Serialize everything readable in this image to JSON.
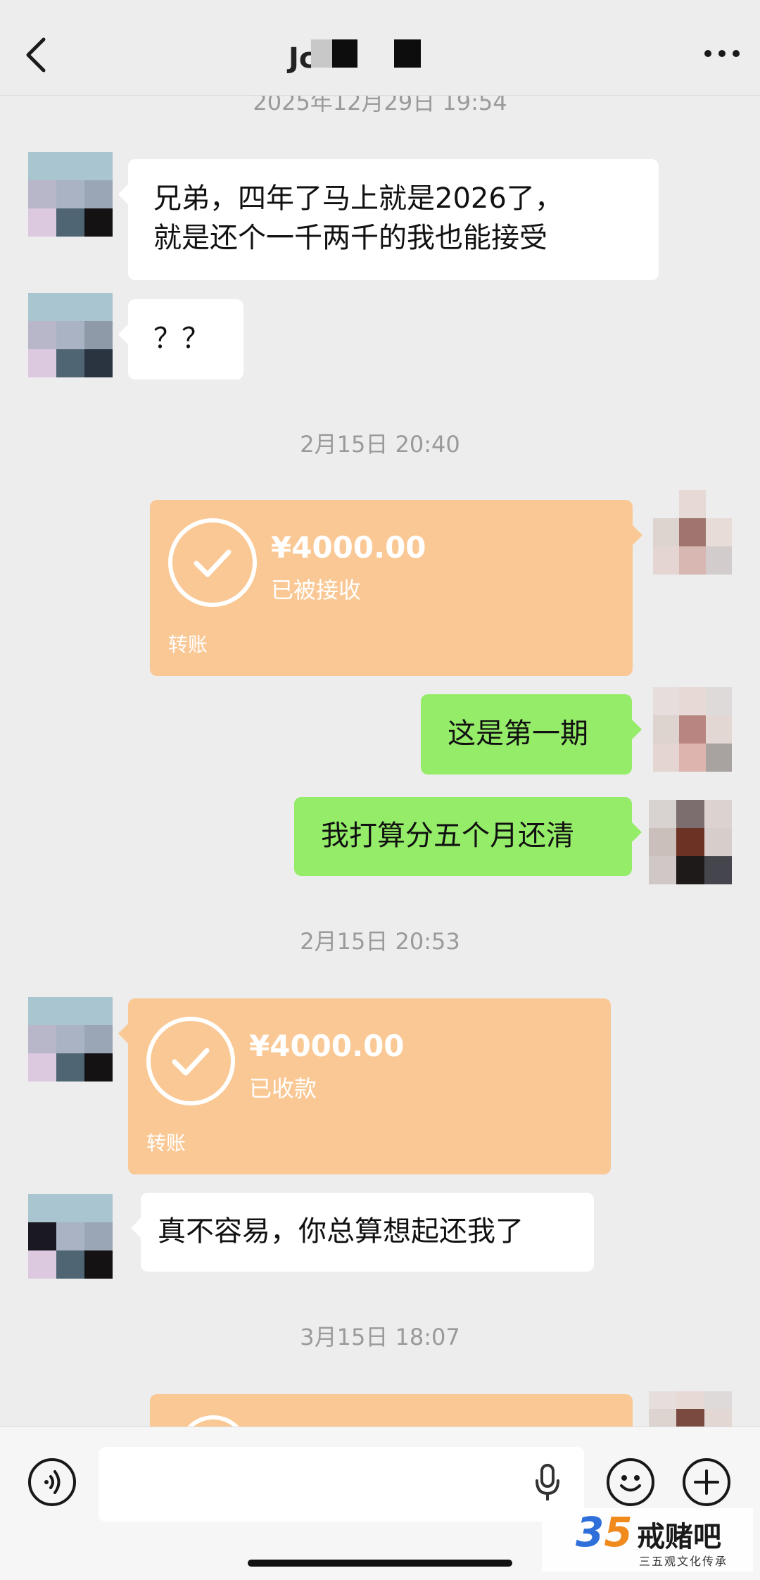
{
  "header": {
    "title": "Jc",
    "back_icon": "chevron-left-icon",
    "more_icon": "more-icon"
  },
  "messages": {
    "ts1": "2025年12月29日 19:54",
    "m1_line1": "兄弟，四年了马上就是2026了，",
    "m1_line2": "就是还个一千两千的我也能接受",
    "m2": "？？",
    "ts2": "2月15日 20:40",
    "t1_amount": "¥4000.00",
    "t1_status": "已被接收",
    "t1_label": "转账",
    "m3": "这是第一期",
    "m4": "我打算分五个月还清",
    "ts3": "2月15日 20:53",
    "t2_amount": "¥4000.00",
    "t2_status": "已收款",
    "t2_label": "转账",
    "m5": "真不容易，你总算想起还我了",
    "ts4": "3月15日 18:07"
  },
  "input_bar": {
    "voice_icon": "voice-icon",
    "mic_icon": "microphone-icon",
    "emoji_icon": "emoji-icon",
    "plus_icon": "plus-icon"
  },
  "watermark": {
    "number_a": "3",
    "number_b": "5",
    "title": "戒赌吧",
    "subtitle": "三五观文化传承"
  },
  "colors": {
    "green_bubble": "#95ec69",
    "transfer_orange": "#fac894",
    "background": "#ededed"
  }
}
